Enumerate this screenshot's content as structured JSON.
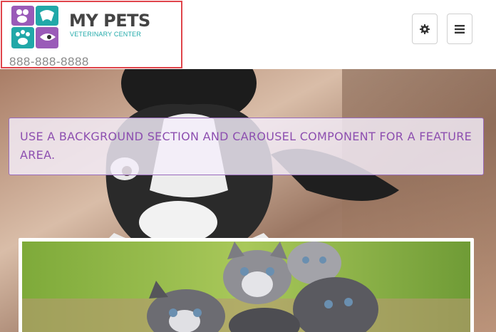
{
  "header": {
    "brand_title": "MY PETS",
    "brand_subtitle": "VETERINARY CENTER",
    "phone": "888-888-8888",
    "settings_icon": "gear-icon",
    "menu_icon": "hamburger-icon"
  },
  "hero": {
    "feature_text": "USE A BACKGROUND SECTION AND CAROUSEL COMPONENT FOR A FEATURE AREA."
  },
  "colors": {
    "brand_purple": "#8d4fb0",
    "brand_teal": "#20a9a9",
    "highlight_border": "#e0454b"
  }
}
